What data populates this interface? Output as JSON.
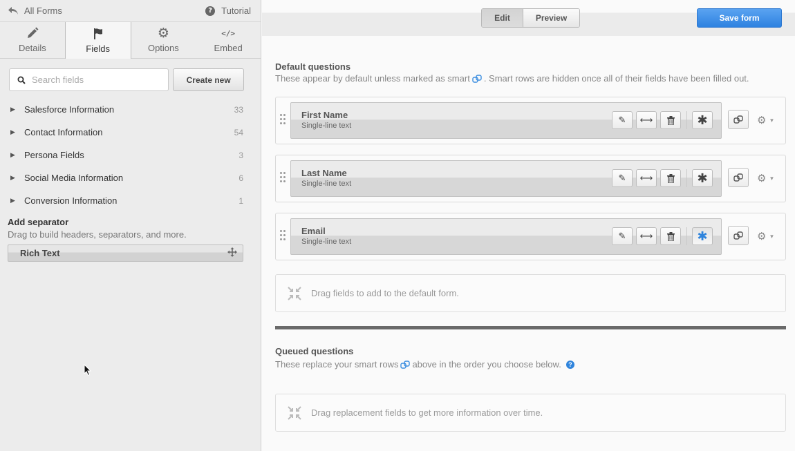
{
  "sidebar": {
    "back_label": "All Forms",
    "tutorial_label": "Tutorial",
    "tabs": [
      {
        "label": "Details",
        "icon": "pencil-icon"
      },
      {
        "label": "Fields",
        "icon": "flag-icon"
      },
      {
        "label": "Options",
        "icon": "gear-icon"
      },
      {
        "label": "Embed",
        "icon": "code-icon"
      }
    ],
    "active_tab": "Fields",
    "search": {
      "placeholder": "Search fields",
      "value": ""
    },
    "create_label": "Create new",
    "groups": [
      {
        "name": "Salesforce Information",
        "count": "33"
      },
      {
        "name": "Contact Information",
        "count": "54"
      },
      {
        "name": "Persona Fields",
        "count": "3"
      },
      {
        "name": "Social Media Information",
        "count": "6"
      },
      {
        "name": "Conversion Information",
        "count": "1"
      }
    ],
    "separator": {
      "title": "Add separator",
      "description": "Drag to build headers, separators, and more.",
      "item_label": "Rich Text"
    }
  },
  "main": {
    "toolbar": {
      "edit_label": "Edit",
      "preview_label": "Preview",
      "save_label": "Save form"
    },
    "default_section": {
      "title": "Default questions",
      "desc_before": "These appear by default unless marked as smart",
      "desc_after": ". Smart rows are hidden once all of their fields have been filled out.",
      "fields": [
        {
          "name": "First Name",
          "type": "Single-line text",
          "required_active": false
        },
        {
          "name": "Last Name",
          "type": "Single-line text",
          "required_active": false
        },
        {
          "name": "Email",
          "type": "Single-line text",
          "required_active": true
        }
      ],
      "dropzone_label": "Drag fields to add to the default form."
    },
    "queued_section": {
      "title": "Queued questions",
      "desc_before": "These replace your smart rows",
      "desc_after": "above in the order you choose below.",
      "dropzone_label": "Drag replacement fields to get more information over time."
    }
  },
  "colors": {
    "accent": "#2e82e0",
    "required_active": "#2f84dc",
    "divider": "#6a6a6a"
  }
}
